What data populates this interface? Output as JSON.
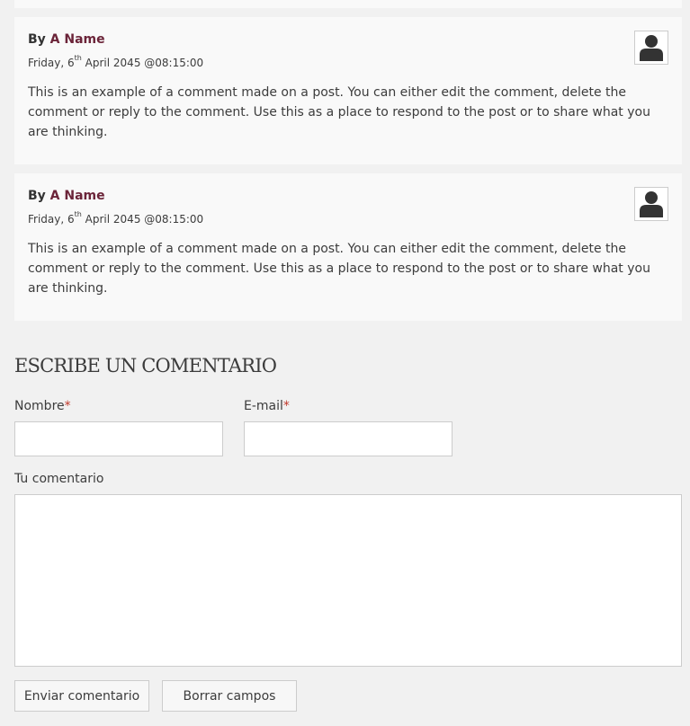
{
  "comments": [
    {
      "by_prefix": "By ",
      "author": "A Name",
      "date_prefix": "Friday, 6",
      "date_sup": "th",
      "date_suffix": " April 2045 @08:15:00",
      "body": "This is an example of a comment made on a post. You can either edit the comment, delete the comment or reply to the comment. Use this as a place to respond to the post or to share what you are thinking.",
      "avatar_icon": "user-silhouette-icon"
    },
    {
      "by_prefix": "By ",
      "author": "A Name",
      "date_prefix": "Friday, 6",
      "date_sup": "th",
      "date_suffix": " April 2045 @08:15:00",
      "body": "This is an example of a comment made on a post. You can either edit the comment, delete the comment or reply to the comment. Use this as a place to respond to the post or to share what you are thinking.",
      "avatar_icon": "user-silhouette-icon"
    }
  ],
  "form": {
    "title": "ESCRIBE UN COMENTARIO",
    "name_label": "Nombre",
    "email_label": "E-mail",
    "required_marker": "*",
    "comment_label": "Tu comentario",
    "name_value": "",
    "email_value": "",
    "comment_value": "",
    "submit_label": "Enviar comentario",
    "reset_label": "Borrar campos"
  },
  "colors": {
    "page_background": "#f1f1f1",
    "comment_background": "#f9f9f9",
    "author_link": "#6b2439",
    "required_marker": "#c0392b",
    "avatar_icon": "#333333"
  }
}
